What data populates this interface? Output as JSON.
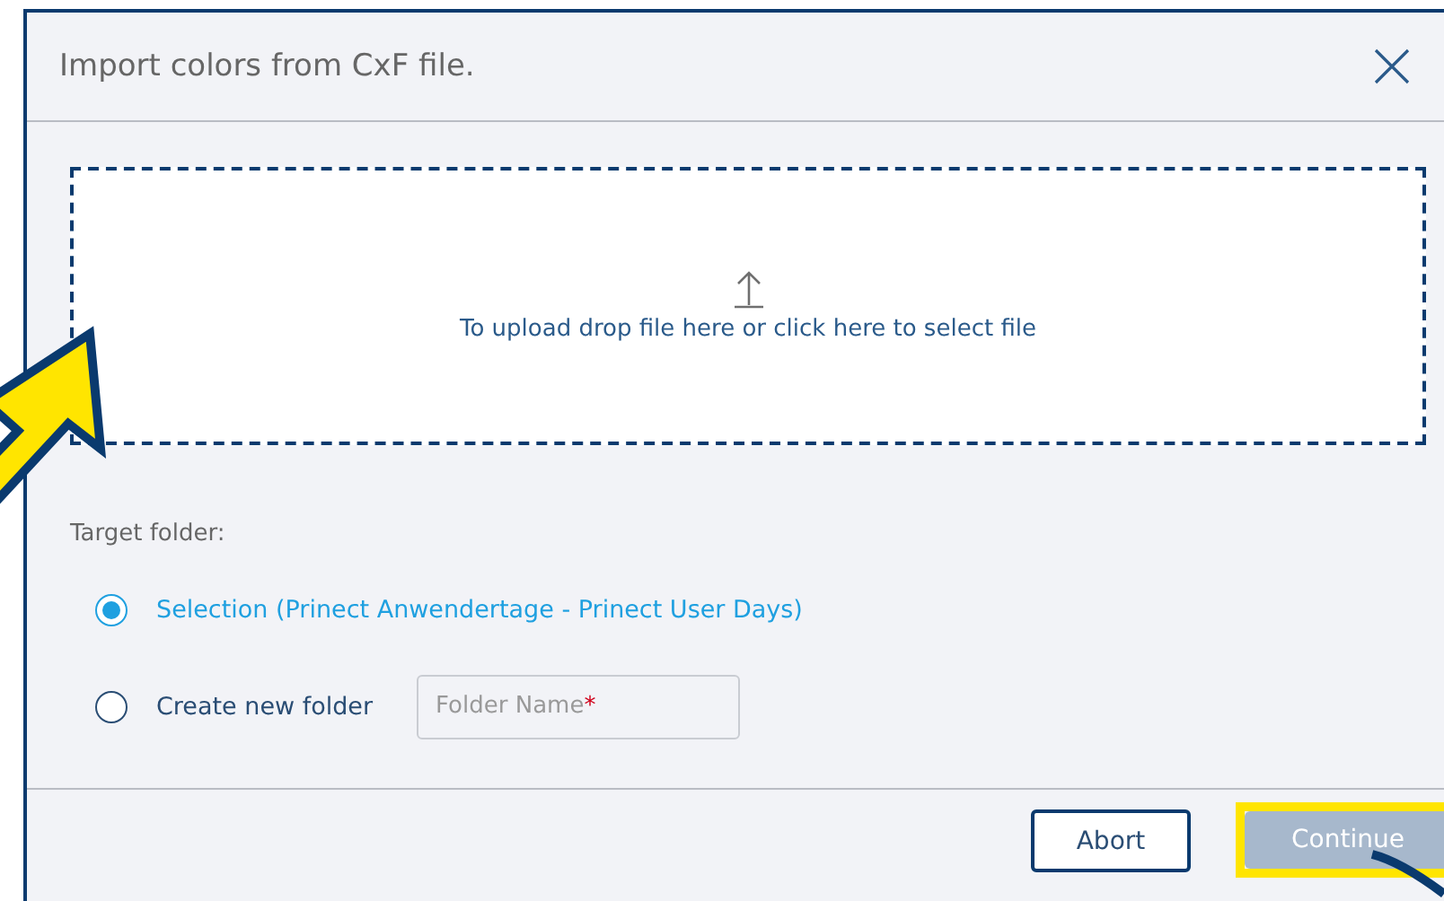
{
  "dialog": {
    "title": "Import colors from CxF file."
  },
  "dropzone": {
    "text": "To upload drop file here or click here to select file"
  },
  "target_folder": {
    "label": "Target folder:",
    "options": [
      {
        "kind": "plain",
        "label": "Selection (Prinect Anwendertage - Prinect User Days)",
        "selected": true
      },
      {
        "kind": "new-folder",
        "label": "Create new folder",
        "selected": false,
        "field": {
          "placeholder": "Folder Name",
          "required_mark": "*"
        }
      }
    ]
  },
  "buttons": [
    {
      "label": "Abort",
      "kind": "secondary",
      "disabled": false,
      "highlighted": false
    },
    {
      "label": "Continue",
      "kind": "primary",
      "disabled": true,
      "highlighted": true
    }
  ]
}
